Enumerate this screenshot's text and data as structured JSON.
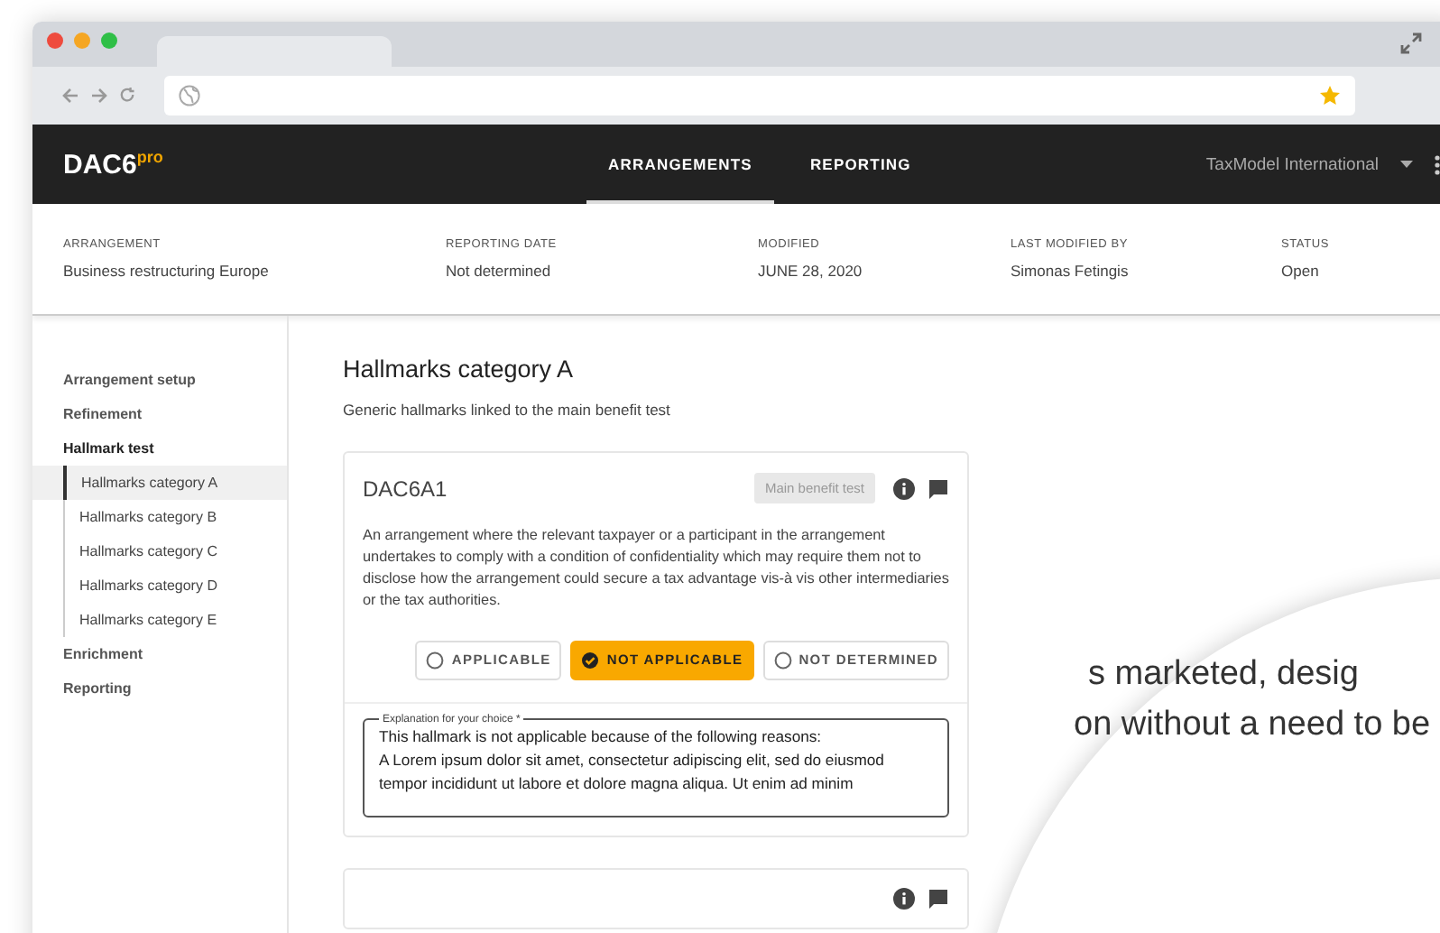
{
  "header": {
    "logo": "DAC6",
    "logo_sup": "pro",
    "nav": [
      {
        "label": "ARRANGEMENTS",
        "selected": true
      },
      {
        "label": "REPORTING",
        "selected": false
      }
    ],
    "account": "TaxModel International"
  },
  "summary": [
    {
      "label": "ARRANGEMENT",
      "value": "Business restructuring Europe"
    },
    {
      "label": "REPORTING DATE",
      "value": "Not determined"
    },
    {
      "label": "MODIFIED",
      "value": "JUNE 28, 2020"
    },
    {
      "label": "LAST MODIFIED BY",
      "value": "Simonas Fetingis"
    },
    {
      "label": "STATUS",
      "value": "Open"
    }
  ],
  "sidebar": {
    "items": [
      {
        "label": "Arrangement setup"
      },
      {
        "label": "Refinement"
      },
      {
        "label": "Hallmark test",
        "expanded": true,
        "children": [
          {
            "label": "Hallmarks category A",
            "selected": true
          },
          {
            "label": "Hallmarks category B",
            "selected": false
          },
          {
            "label": "Hallmarks category C",
            "selected": false
          },
          {
            "label": "Hallmarks category D",
            "selected": false
          },
          {
            "label": "Hallmarks category E",
            "selected": false
          }
        ]
      },
      {
        "label": "Enrichment"
      },
      {
        "label": "Reporting"
      }
    ]
  },
  "content": {
    "title": "Hallmarks category A",
    "subtitle": "Generic hallmarks linked to the main benefit test",
    "cards": [
      {
        "kind": "hallmark",
        "code": "DAC6A1",
        "badge": "Main benefit test",
        "description": "An arrangement where the relevant taxpayer or a participant in the arrangement undertakes to comply with a condition of confidentiality which may require them not to disclose how the arrangement could secure a tax advantage vis-à vis other intermediaries or the tax authorities.",
        "choices": [
          {
            "label": "APPLICABLE",
            "selected": false
          },
          {
            "label": "NOT APPLICABLE",
            "selected": true
          },
          {
            "label": "NOT DETERMINED",
            "selected": false
          }
        ],
        "explanation": {
          "label": "Explanation for your choice *",
          "value": "This hallmark is not applicable because of the following reasons:\nA Lorem ipsum dolor sit amet, consectetur adipiscing elit, sed do eiusmod tempor incididunt ut labore et dolore magna aliqua. Ut enim ad minim"
        }
      },
      {
        "kind": "collapsed"
      }
    ]
  },
  "magnifier": {
    "lines": [
      "s marketed, desig",
      "on without a need to be"
    ]
  }
}
